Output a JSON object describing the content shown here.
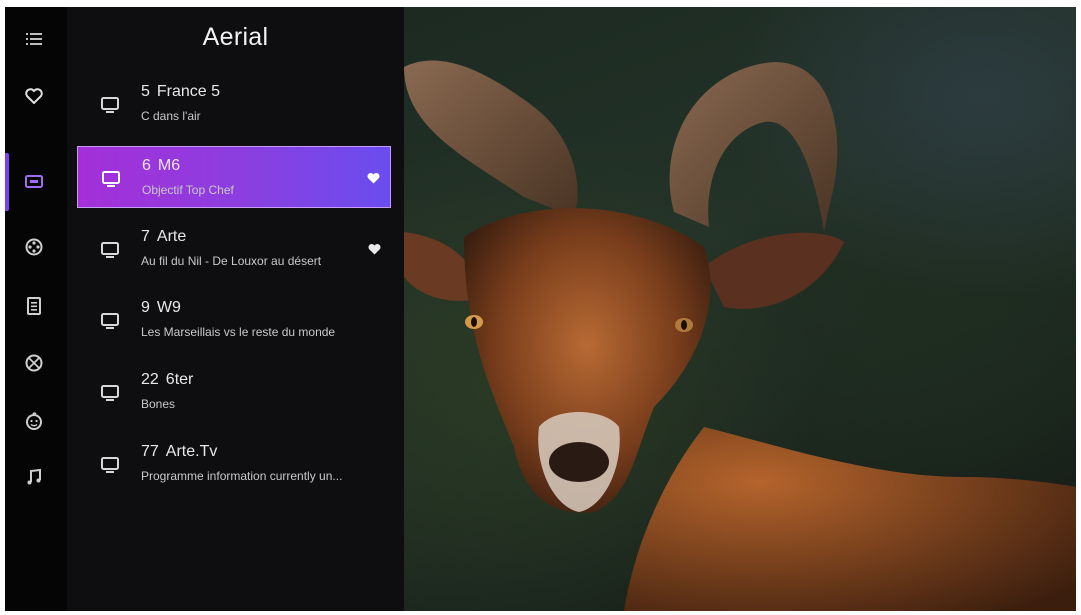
{
  "panel": {
    "title": "Aerial"
  },
  "rail": [
    {
      "icon": "menu-icon"
    },
    {
      "icon": "heart-icon"
    },
    {
      "icon": "tv-channels-icon",
      "active": true
    },
    {
      "icon": "film-reel-icon"
    },
    {
      "icon": "document-icon"
    },
    {
      "icon": "sports-ball-icon"
    },
    {
      "icon": "kids-face-icon"
    },
    {
      "icon": "music-note-icon"
    }
  ],
  "channels": [
    {
      "number": "5",
      "name": "France 5",
      "programme": "C dans l'air",
      "favorite": false,
      "selected": false
    },
    {
      "number": "6",
      "name": "M6",
      "programme": "Objectif Top Chef",
      "favorite": true,
      "selected": true
    },
    {
      "number": "7",
      "name": "Arte",
      "programme": "Au fil du Nil - De Louxor au désert",
      "favorite": true,
      "selected": false
    },
    {
      "number": "9",
      "name": "W9",
      "programme": "Les Marseillais vs le reste du monde",
      "favorite": false,
      "selected": false
    },
    {
      "number": "22",
      "name": "6ter",
      "programme": "Bones",
      "favorite": false,
      "selected": false
    },
    {
      "number": "77",
      "name": "Arte.Tv",
      "programme": "Programme information currently un...",
      "favorite": false,
      "selected": false
    }
  ],
  "colors": {
    "accent": "#9a38dc",
    "panel": "#0e0e11",
    "rail": "#050506"
  }
}
